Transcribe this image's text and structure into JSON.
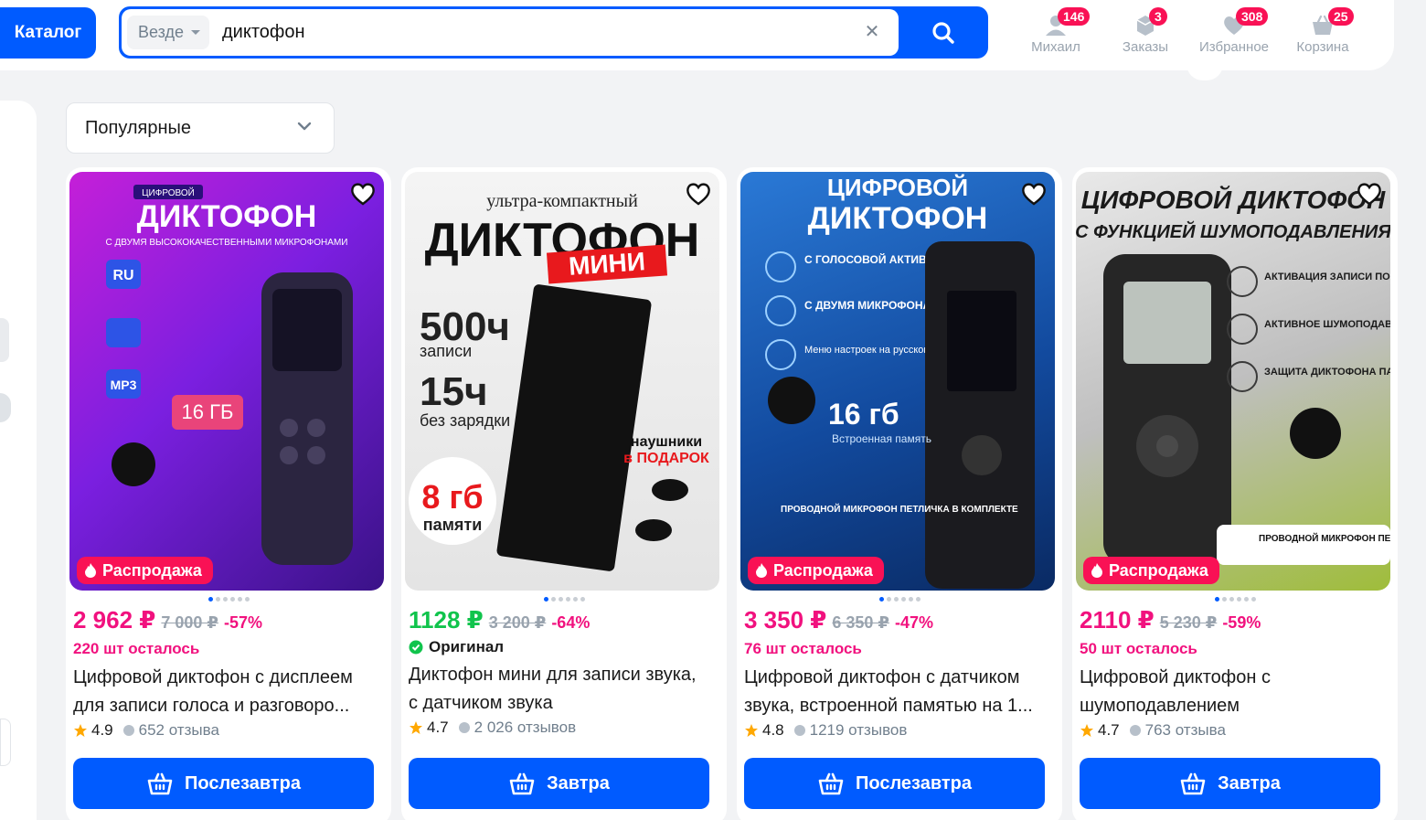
{
  "header": {
    "catalog_label": "Каталог",
    "scope_label": "Везде",
    "search_value": "диктофон",
    "nav": [
      {
        "label": "Михаил",
        "badge": "146",
        "icon": "user-icon"
      },
      {
        "label": "Заказы",
        "badge": "3",
        "icon": "orders-box-icon"
      },
      {
        "label": "Избранное",
        "badge": "308",
        "icon": "heart-icon"
      },
      {
        "label": "Корзина",
        "badge": "25",
        "icon": "cart-icon"
      }
    ]
  },
  "sort": {
    "label": "Популярные"
  },
  "colors": {
    "accent": "#005bff",
    "sale": "#f91155",
    "price_pink": "#f1117e",
    "price_green": "#10c44c"
  },
  "products": [
    {
      "price": "2 962 ₽",
      "old_price": "7 000 ₽",
      "discount": "-57%",
      "price_color": "pink",
      "stock": "220 шт осталось",
      "badge": "Распродажа",
      "title": "Цифровой диктофон с дисплеем для записи голоса и разговоро...",
      "rating": "4.9",
      "reviews": "652 отзыва",
      "delivery": "Послезавтра",
      "image_text": {
        "top": "ЦИФРОВОЙ",
        "main": "ДИКТОФОН",
        "sub": "С ДВУМЯ ВЫСОКОКАЧЕСТВЕННЫМИ МИКРОФОНАМИ",
        "capacity": "16 ГБ"
      }
    },
    {
      "price": "1128 ₽",
      "old_price": "3 200 ₽",
      "discount": "-64%",
      "price_color": "green",
      "original_label": "Оригинал",
      "title": "Диктофон мини для записи звука, с датчиком звука",
      "rating": "4.7",
      "reviews": "2 026 отзывов",
      "delivery": "Завтра",
      "image_text": {
        "top": "ультра-компактный",
        "main": "ДИКТОФОН",
        "tag": "МИНИ",
        "hours": "500ч",
        "hours_sub": "записи",
        "battery": "15ч",
        "battery_sub": "без зарядки",
        "memory": "8 гб",
        "memory_sub": "памяти",
        "gift": "наушники",
        "gift2": "в ПОДАРОК"
      }
    },
    {
      "price": "3 350 ₽",
      "old_price": "6 350 ₽",
      "discount": "-47%",
      "price_color": "pink",
      "stock": "76 шт осталось",
      "badge": "Распродажа",
      "title": "Цифровой диктофон с датчиком звука, встроенной памятью на 1...",
      "rating": "4.8",
      "reviews": "1219 отзывов",
      "delivery": "Послезавтра",
      "image_text": {
        "top": "ЦИФРОВОЙ",
        "main": "ДИКТОФОН",
        "f1": "С ГОЛОСОВОЙ АКТИВАЦИЕЙ",
        "f2": "С ДВУМЯ МИКРОФОНАМИ",
        "f3": "Меню настроек на русском языке",
        "capacity": "16 гб",
        "capacity_sub": "Встроенная память",
        "mic": "ПРОВОДНОЙ МИКРОФОН ПЕТЛИЧКА В КОМПЛЕКТЕ"
      }
    },
    {
      "price": "2110 ₽",
      "old_price": "5 230 ₽",
      "discount": "-59%",
      "price_color": "pink",
      "stock": "50 шт осталось",
      "badge": "Распродажа",
      "title": "Цифровой диктофон с шумоподавлением",
      "rating": "4.7",
      "reviews": "763 отзыва",
      "delivery": "Завтра",
      "image_text": {
        "main": "ЦИФРОВОЙ ДИКТОФОН",
        "sub": "С ФУНКЦИЕЙ ШУМОПОДАВЛЕНИЯ",
        "f1": "АКТИВАЦИЯ ЗАПИСИ ПО ДАТЧИКУ ЗВУКА",
        "f2": "АКТИВНОЕ ШУМОПОДАВЛЕНИЕ",
        "f3": "ЗАЩИТА ДИКТОФОНА ПАРОЛЕМ",
        "gift": "ПРОВОДНОЙ МИКРОФОН ПЕТЛИЧКА В ПОДАРОК"
      }
    }
  ]
}
